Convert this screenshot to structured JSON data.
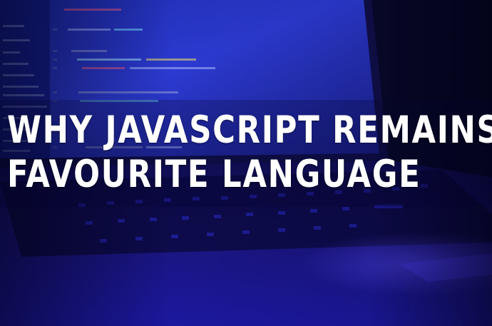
{
  "headline": {
    "line1": "WHY JAVASCRIPT REMAINS MY",
    "line2": "FAVOURITE LANGUAGE"
  },
  "background": {
    "subject": "laptop-with-code-editor-icon",
    "colors": {
      "deep": "#06061c",
      "screen": "#2a35c8",
      "keyboard": "#0f0d55",
      "glow": "#4a3cff"
    }
  }
}
